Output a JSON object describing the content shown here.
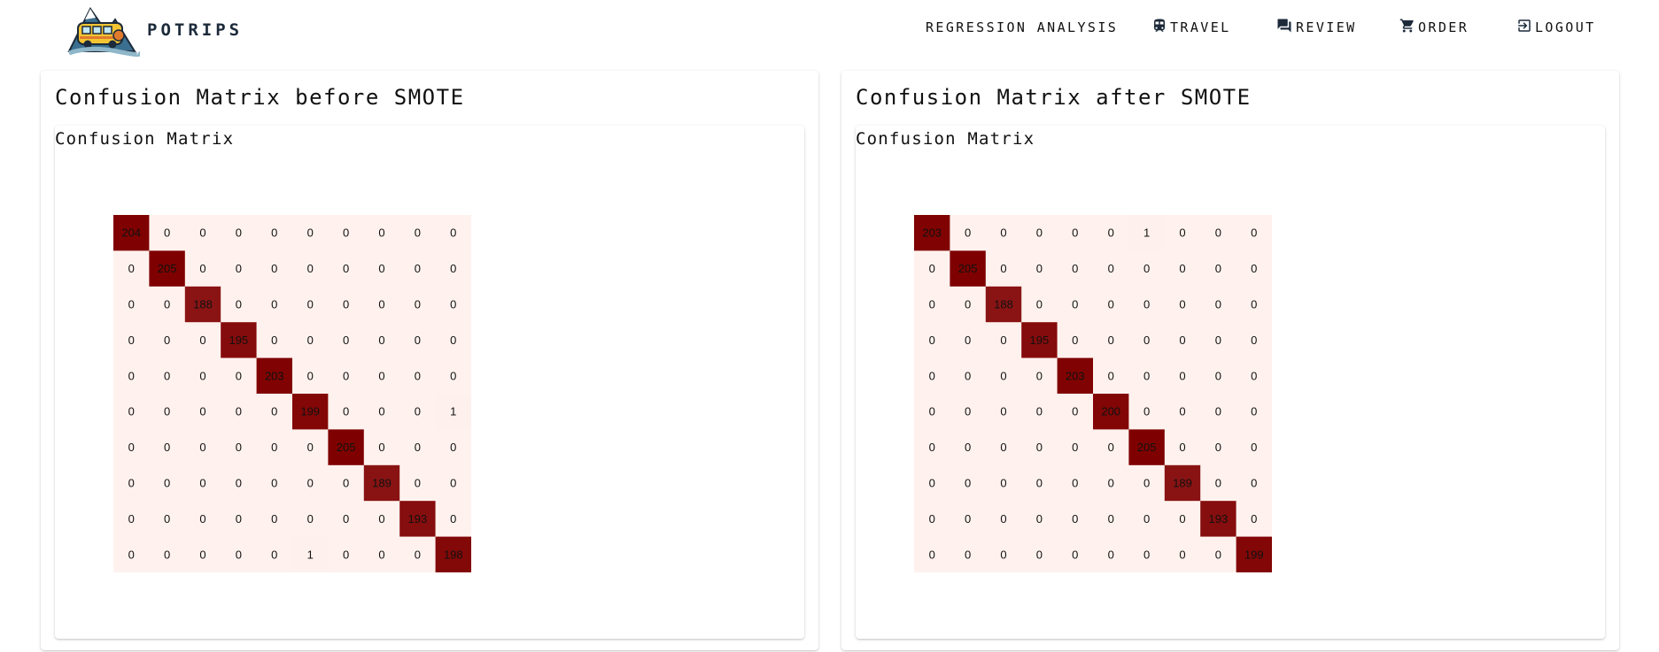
{
  "app": {
    "brand": "POTRIPS",
    "logo_icon": "bus-mountain-logo-icon"
  },
  "nav": [
    {
      "label": "REGRESSION ANALYSIS",
      "icon": ""
    },
    {
      "label": "TRAVEL",
      "icon": "train-icon"
    },
    {
      "label": "REVIEW",
      "icon": "chat-icon"
    },
    {
      "label": "ORDER",
      "icon": "cart-icon"
    },
    {
      "label": "LOGOUT",
      "icon": "logout-icon"
    }
  ],
  "colors": {
    "cell_high": "#7f0000",
    "cell_low": "#fff2ee",
    "text": "#111111"
  },
  "cards": [
    {
      "title": "Confusion Matrix before SMOTE",
      "subtitle": "Confusion Matrix"
    },
    {
      "title": "Confusion Matrix after SMOTE",
      "subtitle": "Confusion Matrix"
    }
  ],
  "chart_data": [
    {
      "type": "heatmap",
      "title": "Confusion Matrix",
      "values": [
        [
          204,
          0,
          0,
          0,
          0,
          0,
          0,
          0,
          0,
          0
        ],
        [
          0,
          205,
          0,
          0,
          0,
          0,
          0,
          0,
          0,
          0
        ],
        [
          0,
          0,
          188,
          0,
          0,
          0,
          0,
          0,
          0,
          0
        ],
        [
          0,
          0,
          0,
          195,
          0,
          0,
          0,
          0,
          0,
          0
        ],
        [
          0,
          0,
          0,
          0,
          203,
          0,
          0,
          0,
          0,
          0
        ],
        [
          0,
          0,
          0,
          0,
          0,
          199,
          0,
          0,
          0,
          1
        ],
        [
          0,
          0,
          0,
          0,
          0,
          0,
          205,
          0,
          0,
          0
        ],
        [
          0,
          0,
          0,
          0,
          0,
          0,
          0,
          189,
          0,
          0
        ],
        [
          0,
          0,
          0,
          0,
          0,
          0,
          0,
          0,
          193,
          0
        ],
        [
          0,
          0,
          0,
          0,
          0,
          1,
          0,
          0,
          0,
          198
        ]
      ]
    },
    {
      "type": "heatmap",
      "title": "Confusion Matrix",
      "values": [
        [
          203,
          0,
          0,
          0,
          0,
          0,
          1,
          0,
          0,
          0
        ],
        [
          0,
          205,
          0,
          0,
          0,
          0,
          0,
          0,
          0,
          0
        ],
        [
          0,
          0,
          188,
          0,
          0,
          0,
          0,
          0,
          0,
          0
        ],
        [
          0,
          0,
          0,
          195,
          0,
          0,
          0,
          0,
          0,
          0
        ],
        [
          0,
          0,
          0,
          0,
          203,
          0,
          0,
          0,
          0,
          0
        ],
        [
          0,
          0,
          0,
          0,
          0,
          200,
          0,
          0,
          0,
          0
        ],
        [
          0,
          0,
          0,
          0,
          0,
          0,
          205,
          0,
          0,
          0
        ],
        [
          0,
          0,
          0,
          0,
          0,
          0,
          0,
          189,
          0,
          0
        ],
        [
          0,
          0,
          0,
          0,
          0,
          0,
          0,
          0,
          193,
          0
        ],
        [
          0,
          0,
          0,
          0,
          0,
          0,
          0,
          0,
          0,
          199
        ]
      ]
    }
  ]
}
